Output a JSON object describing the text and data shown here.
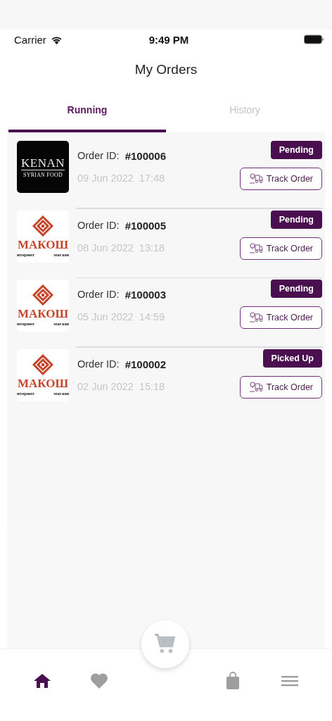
{
  "status_bar": {
    "carrier": "Carrier",
    "time": "9:49 PM"
  },
  "header": {
    "title": "My Orders"
  },
  "tabs": [
    {
      "label": "Running",
      "selected": true
    },
    {
      "label": "History",
      "selected": false
    }
  ],
  "orders": [
    {
      "logo": {
        "kind": "kenan",
        "name": "KENAN",
        "tagline": "SYRIAN FOOD"
      },
      "id_label": "Order ID:",
      "id": "#100006",
      "date": "09 Jun 2022",
      "time": "17:48",
      "status": "Pending",
      "action": "Track Order"
    },
    {
      "logo": {
        "kind": "makosh",
        "name": "МАКОШ",
        "tagline": [
          "нтернет",
          "магази"
        ]
      },
      "id_label": "Order ID:",
      "id": "#100005",
      "date": "08 Jun 2022",
      "time": "13:18",
      "status": "Pending",
      "action": "Track Order"
    },
    {
      "logo": {
        "kind": "makosh",
        "name": "МАКОШ",
        "tagline": [
          "нтернет",
          "магази"
        ]
      },
      "id_label": "Order ID:",
      "id": "#100003",
      "date": "05 Jun 2022",
      "time": "14:59",
      "status": "Pending",
      "action": "Track Order"
    },
    {
      "logo": {
        "kind": "makosh",
        "name": "МАКОШ",
        "tagline": [
          "нтернет",
          "магази"
        ]
      },
      "id_label": "Order ID:",
      "id": "#100002",
      "date": "02 Jun 2022",
      "time": "15:18",
      "status": "Picked Up",
      "action": "Track Order"
    }
  ],
  "bottom_nav": {
    "items": [
      {
        "kind": "home",
        "selected": true
      },
      {
        "kind": "heart",
        "selected": false
      },
      {
        "kind": "cart",
        "selected": false
      },
      {
        "kind": "bag",
        "selected": false
      },
      {
        "kind": "menu",
        "selected": false
      }
    ]
  }
}
